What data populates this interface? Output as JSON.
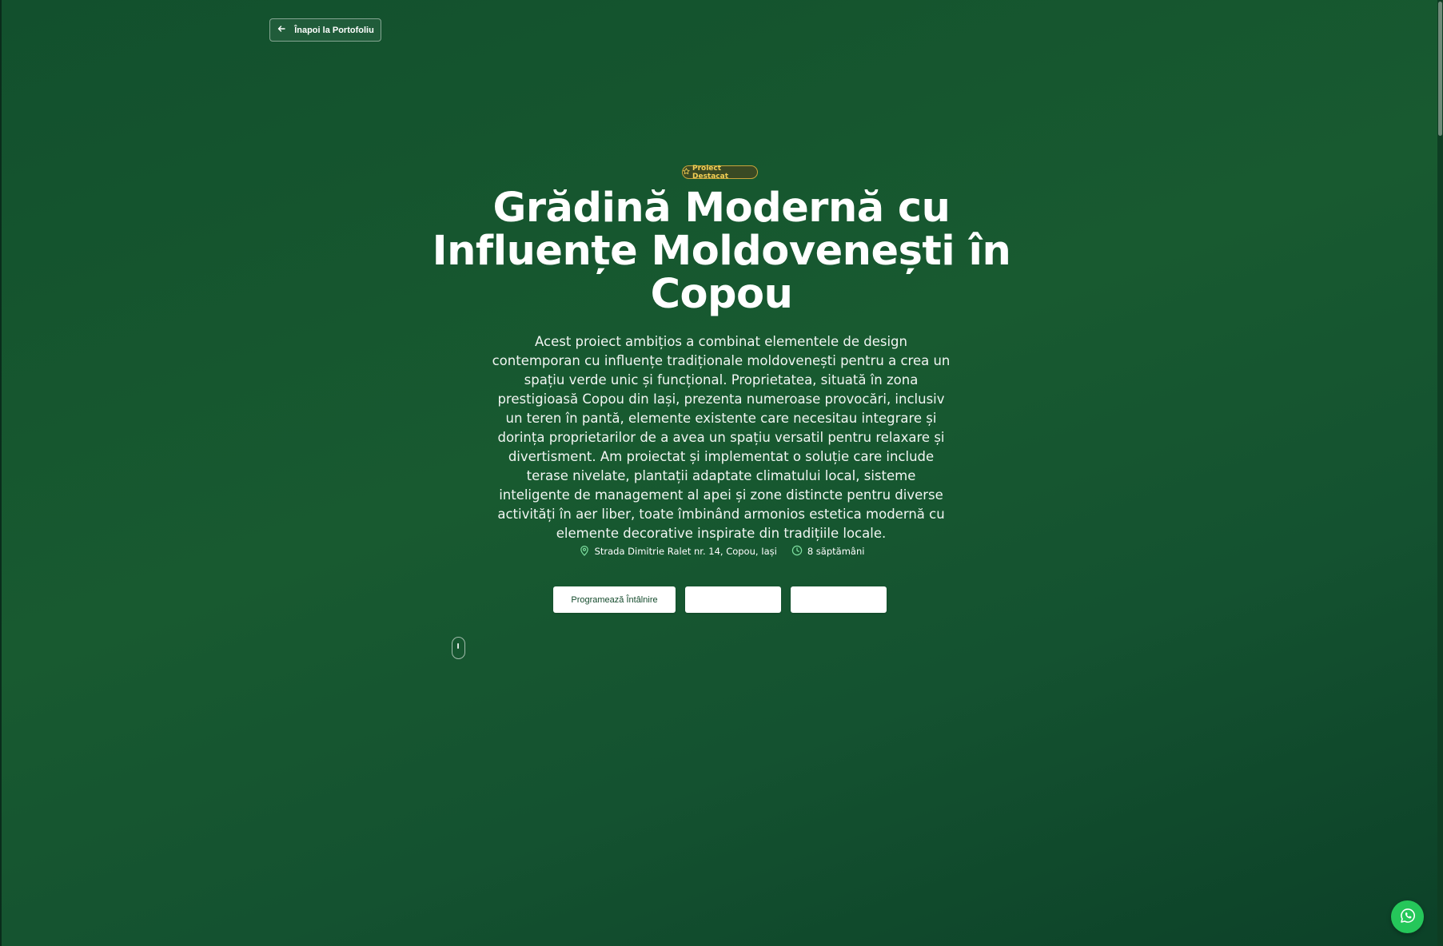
{
  "header": {
    "back_label": "Înapoi la Portofoliu"
  },
  "hero": {
    "badge": "Proiect Destacat",
    "title": "Grădină Modernă cu Influențe Moldovenești în Copou",
    "description": "Acest proiect ambițios a combinat elementele de design contemporan cu influențe tradiționale moldovenești pentru a crea un spațiu verde unic și funcțional. Proprietatea, situată în zona prestigioasă Copou din Iași, prezenta numeroase provocări, inclusiv un teren în pantă, elemente existente care necesitau integrare și dorința proprietarilor de a avea un spațiu versatil pentru relaxare și divertisment. Am proiectat și implementat o soluție care include terase nivelate, plantații adaptate climatului local, sisteme inteligente de management al apei și zone distincte pentru diverse activități în aer liber, toate îmbinând armonios estetica modernă cu elemente decorative inspirate din tradițiile locale.",
    "location": "Strada Dimitrie Ralet nr. 14, Copou, Iași",
    "duration": "8 săptămâni",
    "buttons": {
      "primary": "Programează Întâlnire",
      "secondary": "",
      "tertiary": ""
    }
  },
  "icons": {
    "back": "arrow-left-icon",
    "badge": "star-icon",
    "location": "map-pin-icon",
    "duration": "clock-icon",
    "scroll": "mouse-scroll-icon",
    "floating": "whatsapp-icon"
  },
  "colors": {
    "background_start": "#12502d",
    "background_end": "#0c4128",
    "badge_text": "#f2cf55",
    "badge_border": "#c9a43a",
    "button_text": "#134a2b",
    "whatsapp": "#25c75a"
  }
}
